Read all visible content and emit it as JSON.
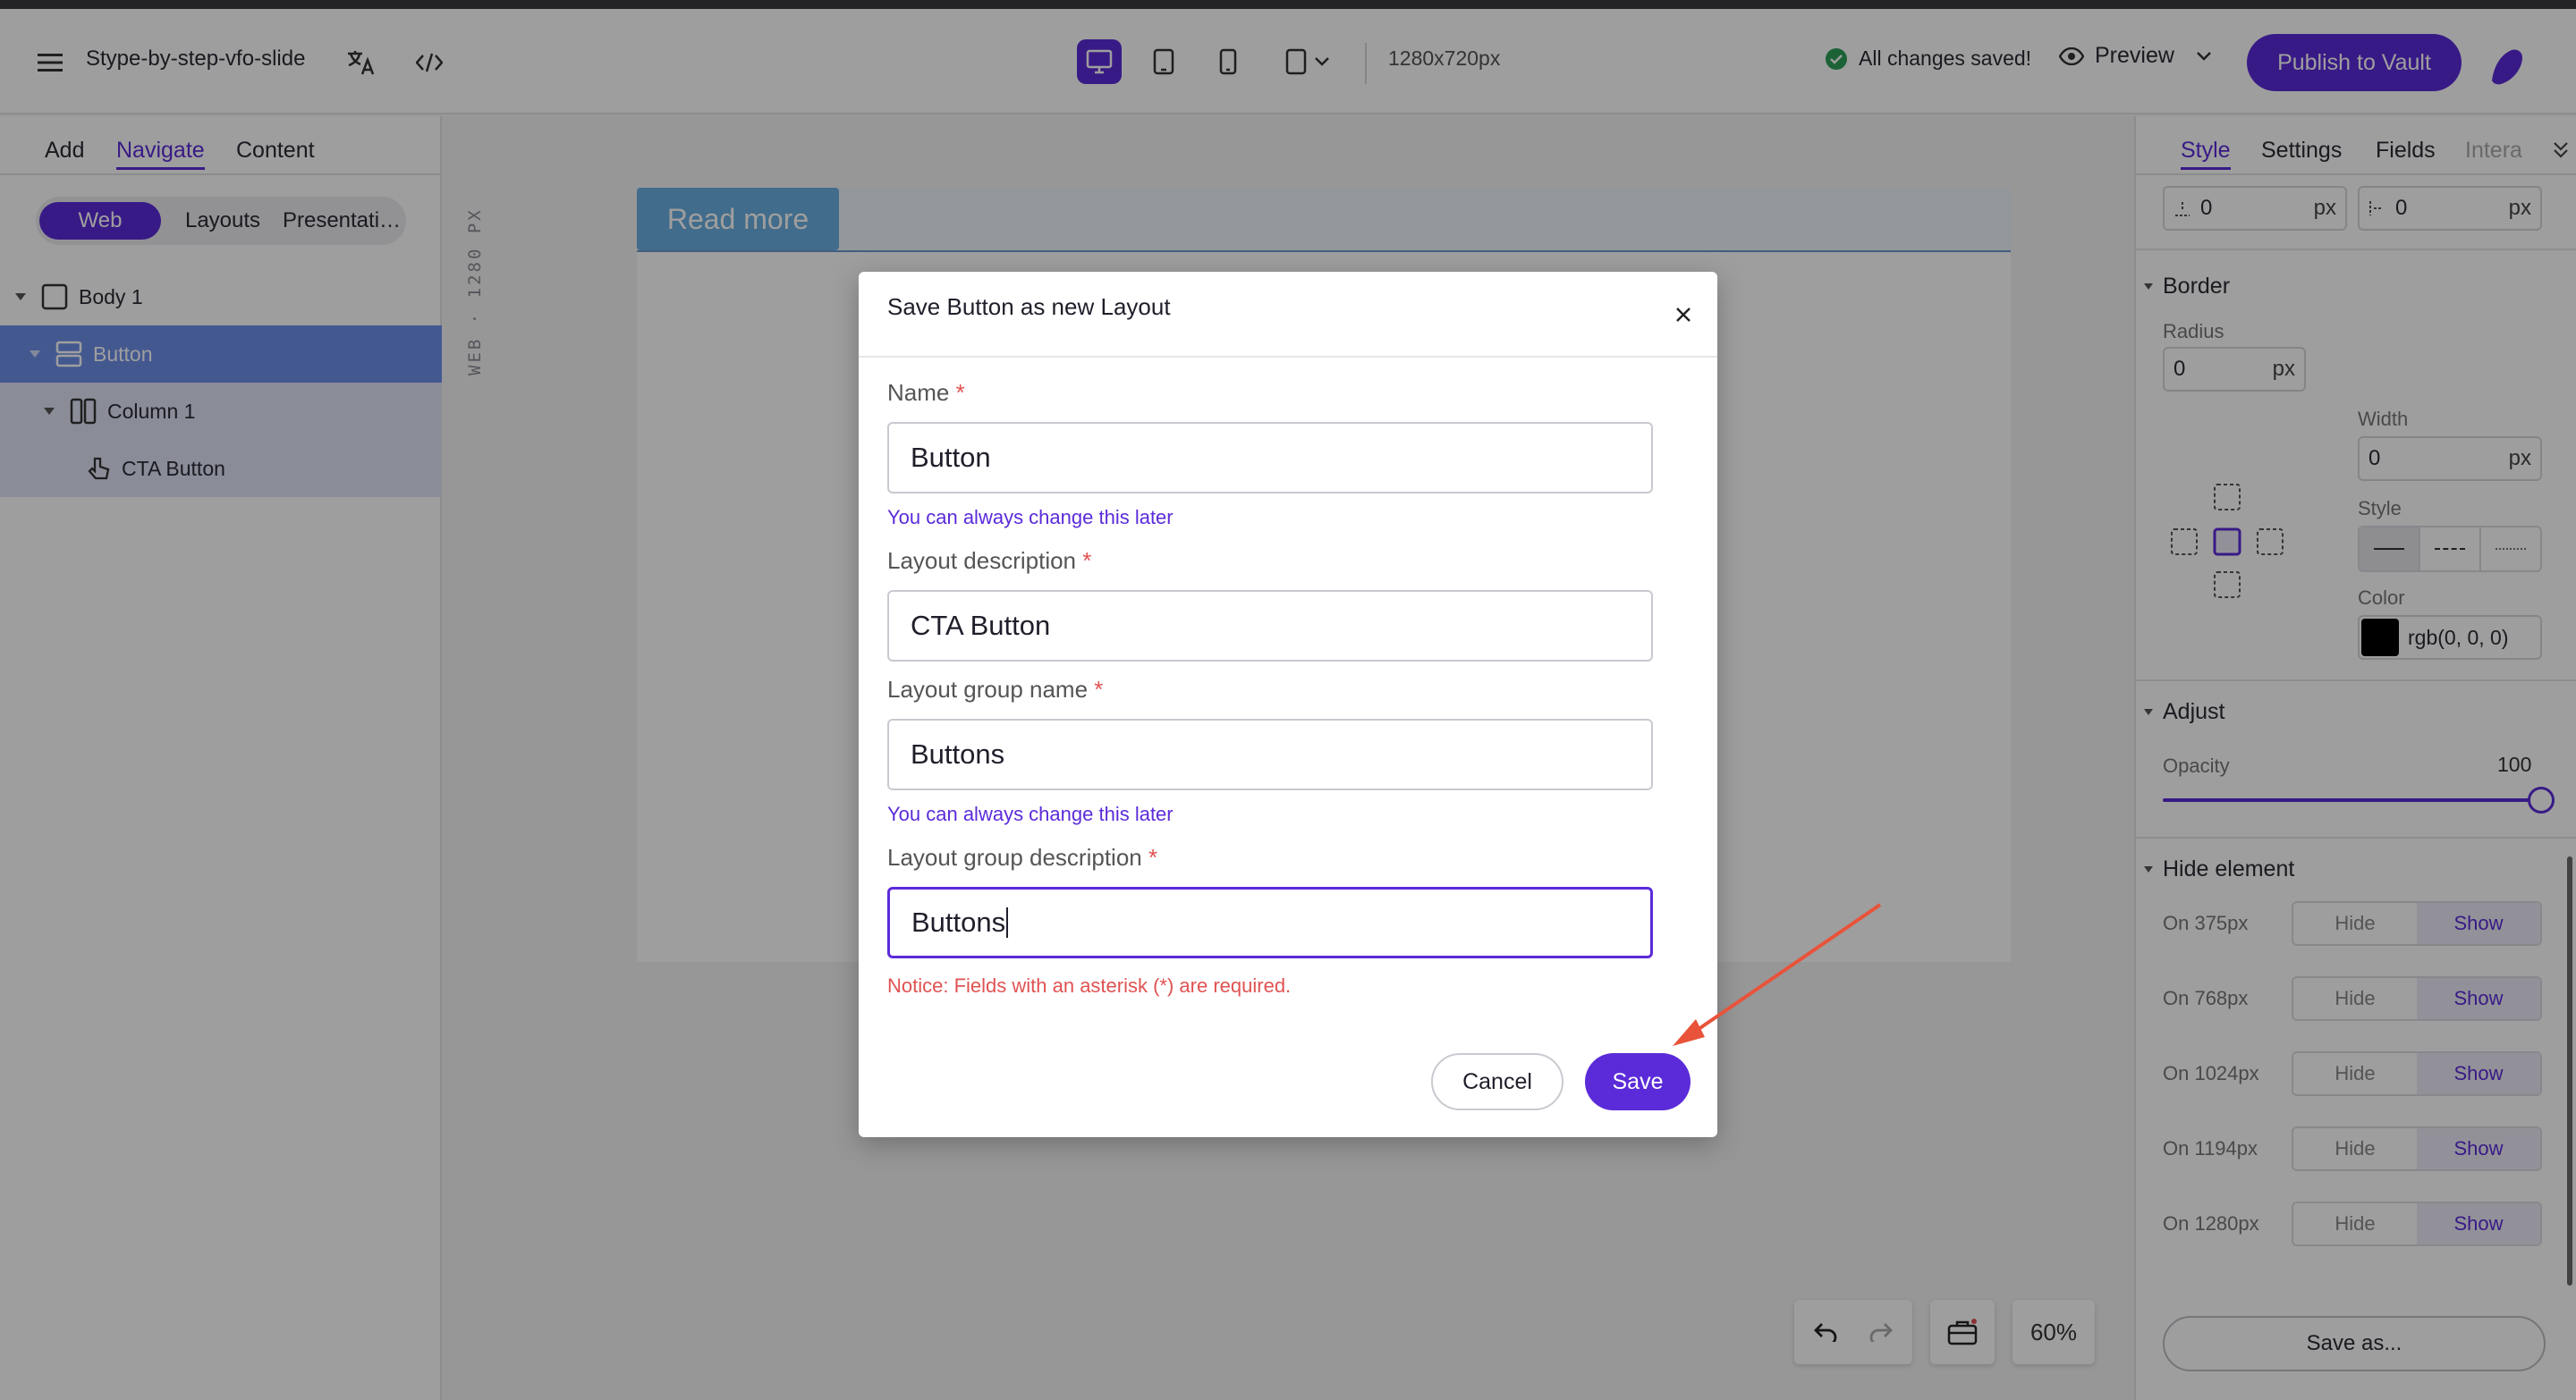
{
  "header": {
    "document_title": "Stype-by-step-vfo-slide",
    "resolution": "1280x720px",
    "saved_status": "All changes saved!",
    "preview_label": "Preview",
    "publish_label": "Publish to Vault"
  },
  "left_panel": {
    "tabs": [
      "Add",
      "Navigate",
      "Content"
    ],
    "active_tab": "Navigate",
    "segments": [
      "Web",
      "Layouts",
      "Presentati…"
    ],
    "tree": [
      {
        "label": "Body 1",
        "icon": "square-icon"
      },
      {
        "label": "Button",
        "icon": "rows-icon"
      },
      {
        "label": "Column 1",
        "icon": "columns-icon"
      },
      {
        "label": "CTA Button",
        "icon": "pointer-icon"
      }
    ]
  },
  "canvas": {
    "vertical_label": "WEB · 1280 PX",
    "read_more": "Read more",
    "zoom": "60%"
  },
  "right_panel": {
    "tabs": [
      "Style",
      "Settings",
      "Fields",
      "Intera"
    ],
    "spacing": {
      "top_value": "0",
      "top_unit": "px",
      "left_value": "0",
      "left_unit": "px"
    },
    "border": {
      "title": "Border",
      "radius_label": "Radius",
      "radius_value": "0",
      "radius_unit": "px",
      "width_label": "Width",
      "width_value": "0",
      "width_unit": "px",
      "style_label": "Style",
      "color_label": "Color",
      "color_value": "rgb(0, 0, 0)"
    },
    "adjust": {
      "title": "Adjust",
      "opacity_label": "Opacity",
      "opacity_value": "100"
    },
    "hide_element": {
      "title": "Hide element",
      "hide_label": "Hide",
      "show_label": "Show",
      "rows": [
        "On 375px",
        "On 768px",
        "On 1024px",
        "On 1194px",
        "On 1280px"
      ]
    },
    "save_as": "Save as..."
  },
  "modal": {
    "title": "Save Button as new Layout",
    "name_label": "Name",
    "name_value": "Button",
    "hint1": "You can always change this later",
    "layout_desc_label": "Layout description",
    "layout_desc_value": "CTA Button",
    "group_name_label": "Layout group name",
    "group_name_value": "Buttons",
    "hint2": "You can always change this later",
    "group_desc_label": "Layout group description",
    "group_desc_value": "Buttons",
    "required_mark": "*",
    "notice": "Notice: Fields with an asterisk (*) are required.",
    "cancel_label": "Cancel",
    "save_label": "Save"
  },
  "colors": {
    "accent": "#5b2bd9",
    "annotation_arrow": "#e8533a",
    "tree_selected": "#6e8ee8",
    "read_more": "#69aee0"
  }
}
